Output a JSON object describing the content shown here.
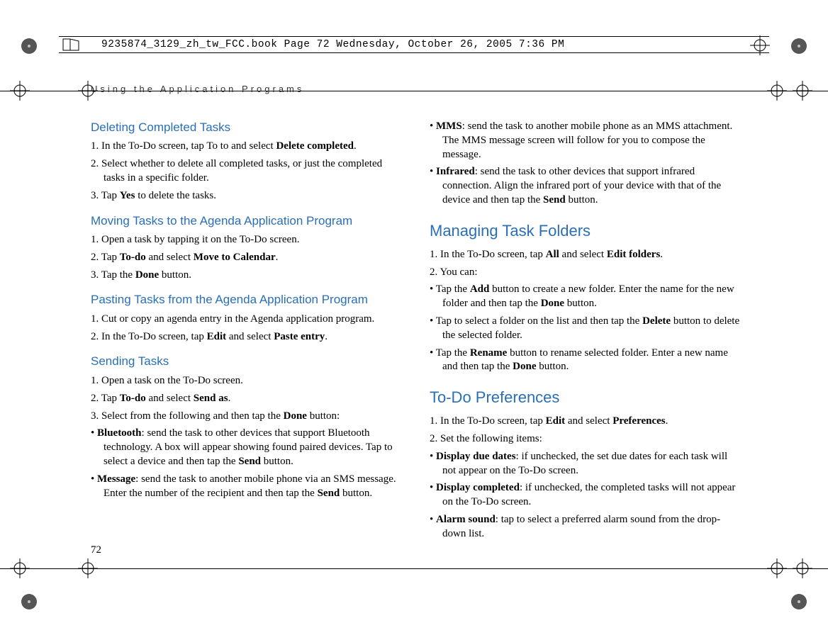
{
  "header": {
    "filetag": "9235874_3129_zh_tw_FCC.book  Page 72  Wednesday, October 26, 2005  7:36 PM"
  },
  "running_head": "Using the Application Programs",
  "page_number": "72",
  "col1": {
    "s1_title": "Deleting Completed Tasks",
    "s1_p1a": "1. In the To-Do screen, tap To to and select ",
    "s1_p1b": "Delete completed",
    "s1_p1c": ".",
    "s1_p2": "2. Select whether to delete all completed tasks, or just the completed tasks in a specific folder.",
    "s1_p3a": "3. Tap ",
    "s1_p3b": "Yes",
    "s1_p3c": " to delete the tasks.",
    "s2_title": "Moving Tasks to the Agenda Application Program",
    "s2_p1": "1. Open a task by tapping it on the To-Do screen.",
    "s2_p2a": "2. Tap ",
    "s2_p2b": "To-do",
    "s2_p2c": " and select ",
    "s2_p2d": "Move to Calendar",
    "s2_p2e": ".",
    "s2_p3a": "3. Tap the ",
    "s2_p3b": "Done",
    "s2_p3c": " button.",
    "s3_title": "Pasting Tasks from the Agenda Application Program",
    "s3_p1": "1. Cut or copy an agenda entry in the Agenda application program.",
    "s3_p2a": "2. In the To-Do screen, tap ",
    "s3_p2b": "Edit",
    "s3_p2c": " and select ",
    "s3_p2d": "Paste entry",
    "s3_p2e": ".",
    "s4_title": "Sending Tasks",
    "s4_p1": "1. Open a task on the To-Do screen.",
    "s4_p2a": "2. Tap ",
    "s4_p2b": "To-do",
    "s4_p2c": " and select ",
    "s4_p2d": "Send as",
    "s4_p2e": ".",
    "s4_p3a": "3. Select from the following and then tap the ",
    "s4_p3b": "Done",
    "s4_p3c": " button:",
    "s4_b1a": "• ",
    "s4_b1b": "Bluetooth",
    "s4_b1c": ": send the task to other devices that support Bluetooth technology. A box will appear showing found paired devices. Tap to select a device and then tap the ",
    "s4_b1d": "Send",
    "s4_b1e": " button.",
    "s4_b2a": "• ",
    "s4_b2b": "Message",
    "s4_b2c": ": send the task to another mobile phone via an SMS message. Enter the number of the recipient and then tap the ",
    "s4_b2d": "Send",
    "s4_b2e": " button."
  },
  "col2": {
    "s4_b3a": "• ",
    "s4_b3b": "MMS",
    "s4_b3c": ": send the task to another mobile phone as an MMS attachment. The MMS message screen will follow for you to compose the message.",
    "s4_b4a": "• ",
    "s4_b4b": "Infrared",
    "s4_b4c": ": send the task to other devices that support infrared connection. Align the infrared port of your device with that of the device and then tap the ",
    "s4_b4d": "Send",
    "s4_b4e": " button.",
    "s5_title": "Managing Task Folders",
    "s5_p1a": "1. In the To-Do screen, tap ",
    "s5_p1b": "All",
    "s5_p1c": " and select ",
    "s5_p1d": "Edit folders",
    "s5_p1e": ".",
    "s5_p2": "2. You can:",
    "s5_b1a": "• Tap the ",
    "s5_b1b": "Add",
    "s5_b1c": " button to create a new folder. Enter the name for the new folder and then tap the ",
    "s5_b1d": "Done",
    "s5_b1e": " button.",
    "s5_b2a": "•  Tap to select a folder on the list and then tap the ",
    "s5_b2b": "Delete",
    "s5_b2c": " button to delete the selected folder.",
    "s5_b3a": "• Tap the ",
    "s5_b3b": "Rename",
    "s5_b3c": " button to rename selected folder. Enter a new name and then tap the ",
    "s5_b3d": "Done",
    "s5_b3e": " button.",
    "s6_title": "To-Do Preferences",
    "s6_p1a": "1. In the To-Do screen, tap ",
    "s6_p1b": "Edit",
    "s6_p1c": " and select ",
    "s6_p1d": "Preferences",
    "s6_p1e": ".",
    "s6_p2": "2. Set the following items:",
    "s6_b1a": "• ",
    "s6_b1b": "Display due dates",
    "s6_b1c": ": if unchecked, the set due dates for each task will not appear on the To-Do screen.",
    "s6_b2a": "• ",
    "s6_b2b": "Display completed",
    "s6_b2c": ": if unchecked, the completed tasks will not appear on the To-Do screen.",
    "s6_b3a": "• ",
    "s6_b3b": "Alarm sound",
    "s6_b3c": ": tap to select a preferred alarm sound from the drop-down list."
  }
}
